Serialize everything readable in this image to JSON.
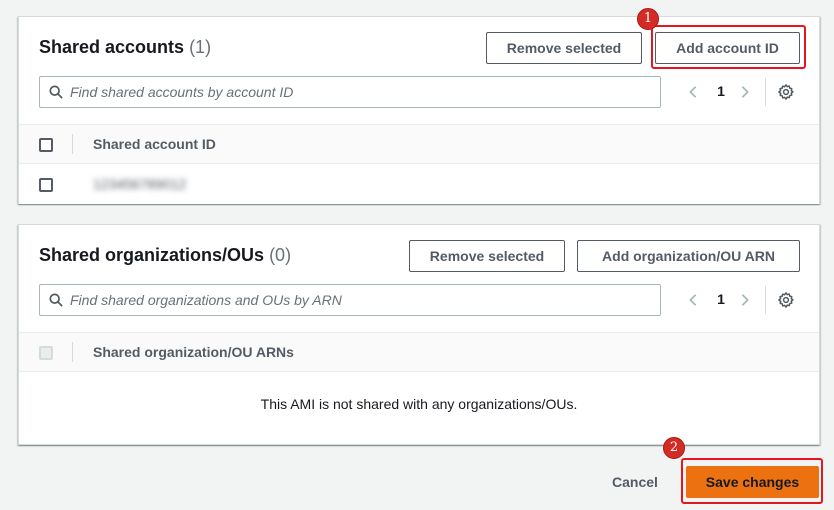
{
  "shared_accounts": {
    "title": "Shared accounts",
    "count": "(1)",
    "remove_button": "Remove selected",
    "add_button": "Add account ID",
    "search_placeholder": "Find shared accounts by account ID",
    "page": "1",
    "column_header": "Shared account ID",
    "rows": [
      {
        "account_id": "123456789012"
      }
    ]
  },
  "shared_orgs": {
    "title": "Shared organizations/OUs",
    "count": "(0)",
    "remove_button": "Remove selected",
    "add_button": "Add organization/OU ARN",
    "search_placeholder": "Find shared organizations and OUs by ARN",
    "page": "1",
    "column_header": "Shared organization/OU ARNs",
    "empty_message": "This AMI is not shared with any organizations/OUs."
  },
  "footer": {
    "cancel": "Cancel",
    "save": "Save changes"
  },
  "annotations": {
    "badge_1": "1",
    "badge_2": "2"
  },
  "colors": {
    "primary": "#ec7211",
    "callout": "#e5171e",
    "badge": "#d42b24"
  },
  "icons": [
    "search-icon",
    "chevron-left-icon",
    "chevron-right-icon",
    "gear-icon"
  ]
}
